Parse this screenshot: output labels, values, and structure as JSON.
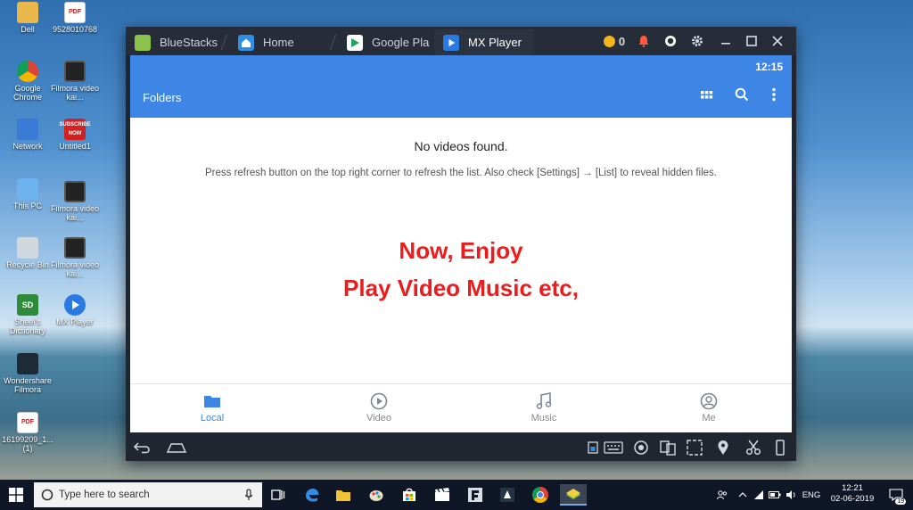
{
  "desktop": {
    "icons": [
      {
        "label": "Dell",
        "glyph": "folder"
      },
      {
        "label": "9528010768",
        "glyph": "PDF"
      },
      {
        "label": "Google Chrome",
        "glyph": "chrome"
      },
      {
        "label": "Filmora video kai...",
        "glyph": "film"
      },
      {
        "label": "Network",
        "glyph": "network"
      },
      {
        "label": "Untitled1",
        "glyph": "SUBSCRIBE NOW"
      },
      {
        "label": "This PC",
        "glyph": "pc"
      },
      {
        "label": "Filmora video kai...",
        "glyph": "film"
      },
      {
        "label": "Recycle Bin",
        "glyph": "bin"
      },
      {
        "label": "Filmora video kai...",
        "glyph": "film"
      },
      {
        "label": "Sheel's Dictionary",
        "glyph": "SD"
      },
      {
        "label": "MX Player",
        "glyph": "mx"
      },
      {
        "label": "Wondershare Filmora",
        "glyph": "ws"
      },
      {
        "label": "16199209_1... (1)",
        "glyph": "PDF"
      }
    ]
  },
  "bluestacks": {
    "tabs": [
      {
        "label": "BlueStacks"
      },
      {
        "label": "Home"
      },
      {
        "label": "Google Pla"
      },
      {
        "label": "MX Player"
      }
    ],
    "coins": "0"
  },
  "mx": {
    "status_time": "12:15",
    "title": "Folders",
    "empty_title": "No videos found.",
    "empty_hint": "Press refresh button on the top right corner to refresh the list. Also check [Settings] → [List] to reveal hidden files.",
    "nav": [
      {
        "label": "Local"
      },
      {
        "label": "Video"
      },
      {
        "label": "Music"
      },
      {
        "label": "Me"
      }
    ],
    "accent": "#3d86e6"
  },
  "overlay": {
    "line1": "Now, Enjoy",
    "line2": "Play Video Music etc,"
  },
  "taskbar": {
    "search_placeholder": "Type here to search",
    "lang": "ENG",
    "time": "12:21",
    "date": "02-06-2019",
    "notifications": "19"
  }
}
